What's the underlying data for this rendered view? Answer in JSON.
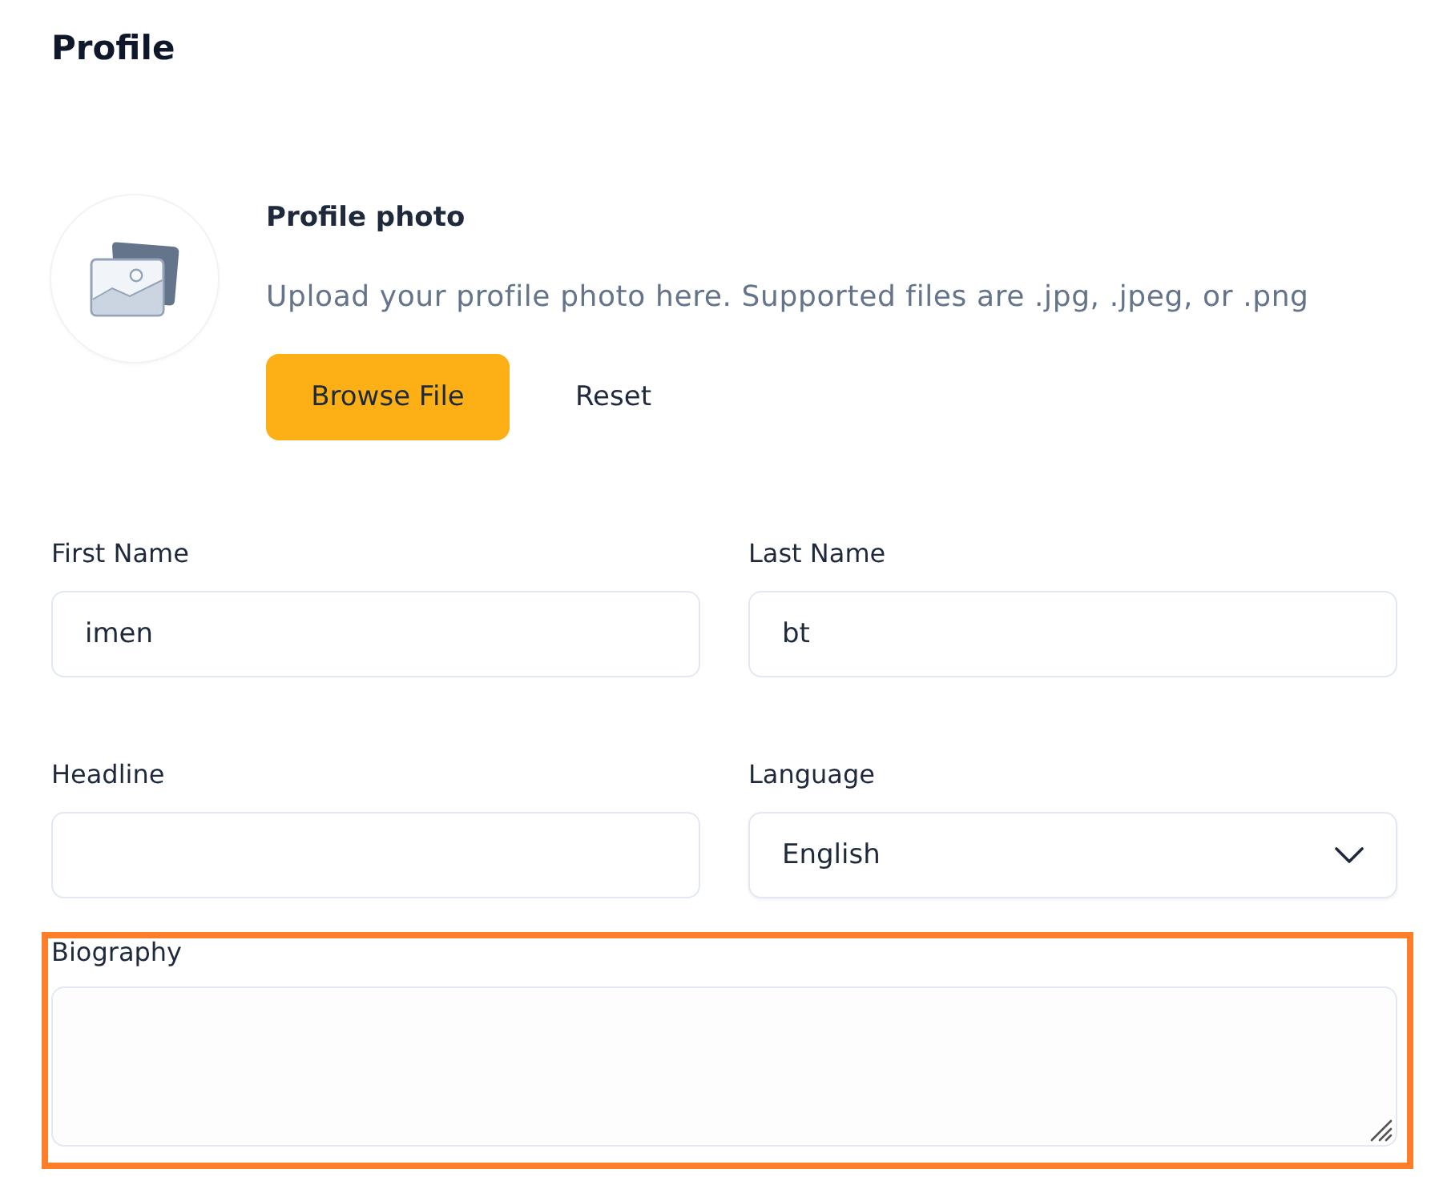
{
  "page": {
    "title": "Profile"
  },
  "photo": {
    "title": "Profile photo",
    "description": "Upload your profile photo here. Supported files are .jpg, .jpeg, or .png",
    "buttons": [
      {
        "label": "Browse File",
        "kind": "primary"
      },
      {
        "label": "Reset",
        "kind": "plain"
      }
    ]
  },
  "fields": [
    {
      "label": "First Name",
      "kind": "text",
      "value": "imen",
      "highlighted": false
    },
    {
      "label": "Last Name",
      "kind": "text",
      "value": "bt",
      "highlighted": false
    },
    {
      "label": "Headline",
      "kind": "text",
      "highlighted": false
    },
    {
      "label": "Language",
      "kind": "select",
      "value": "English",
      "highlighted": false
    },
    {
      "label": "Biography",
      "kind": "textarea",
      "highlighted": true
    }
  ]
}
